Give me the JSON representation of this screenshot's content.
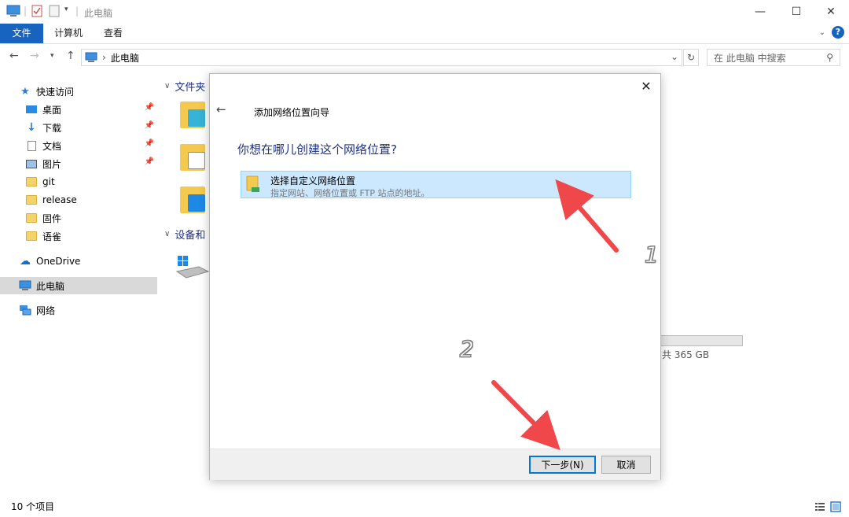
{
  "window": {
    "title": "此电脑",
    "controls": {
      "minimize": "—",
      "maximize": "☐",
      "close": "✕"
    }
  },
  "ribbon": {
    "tabs": [
      "文件",
      "计算机",
      "查看"
    ],
    "help": "?"
  },
  "address": {
    "path": "此电脑",
    "separator": "›",
    "search_placeholder": "在 此电脑 中搜索"
  },
  "sidebar": {
    "quick_access": "快速访问",
    "items": [
      {
        "label": "桌面",
        "icon": "desktop-icon",
        "pinned": true
      },
      {
        "label": "下载",
        "icon": "download-icon",
        "pinned": true
      },
      {
        "label": "文档",
        "icon": "document-icon",
        "pinned": true
      },
      {
        "label": "图片",
        "icon": "picture-icon",
        "pinned": true
      },
      {
        "label": "git",
        "icon": "folder-icon",
        "pinned": false
      },
      {
        "label": "release",
        "icon": "folder-icon",
        "pinned": false
      },
      {
        "label": "固件",
        "icon": "folder-icon",
        "pinned": false
      },
      {
        "label": "语雀",
        "icon": "folder-icon",
        "pinned": false
      }
    ],
    "onedrive": "OneDrive",
    "this_pc": "此电脑",
    "network": "网络"
  },
  "content": {
    "group_folders": "文件夹",
    "group_devices": "设备和",
    "disk_text": "共 365 GB"
  },
  "statusbar": {
    "item_count": "10 个项目"
  },
  "dialog": {
    "title": "添加网络位置向导",
    "heading": "你想在哪儿创建这个网络位置?",
    "option_title": "选择自定义网络位置",
    "option_desc": "指定网站、网络位置或 FTP 站点的地址。",
    "next_button": "下一步(N)",
    "cancel_button": "取消"
  },
  "annotations": {
    "marker_1": "1",
    "marker_2": "2",
    "arrow_color": "#f0474a"
  },
  "colors": {
    "accent": "#1664c0",
    "heading": "#1e3287",
    "selection": "#cce8ff"
  }
}
